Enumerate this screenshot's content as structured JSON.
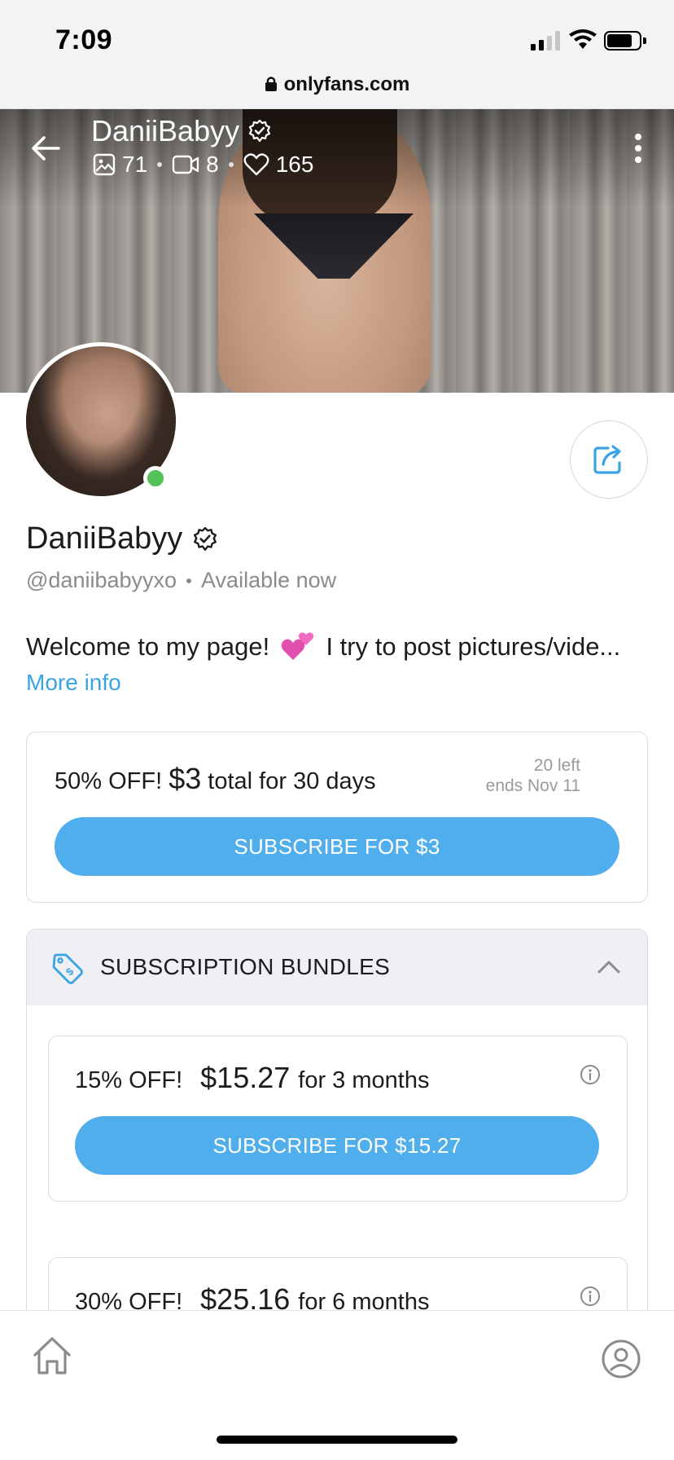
{
  "status_bar": {
    "time": "7:09"
  },
  "browser": {
    "url": "onlyfans.com"
  },
  "cover": {
    "name": "DaniiBabyy",
    "stats": {
      "photos": "71",
      "videos": "8",
      "likes": "165"
    }
  },
  "profile": {
    "name": "DaniiBabyy",
    "handle": "@daniibabyyxo",
    "status": "Available now",
    "bio_before": "Welcome to my page! ",
    "bio_after": " I try to post pictures/vide...",
    "more_info": "More info"
  },
  "offer": {
    "prefix": "50% OFF! ",
    "price": "$3",
    "suffix": " total for 30 days",
    "remaining": "20 left",
    "ends": "ends Nov 11",
    "button": "SUBSCRIBE FOR $3"
  },
  "bundles": {
    "title": "SUBSCRIPTION BUNDLES",
    "items": [
      {
        "discount": "15% OFF!",
        "price": "$15.27",
        "period": "for 3 months",
        "button": "SUBSCRIBE FOR $15.27"
      },
      {
        "discount": "30% OFF!",
        "price": "$25.16",
        "period": "for 6 months"
      }
    ]
  },
  "colors": {
    "accent": "#4faeeb",
    "link": "#3aa3e3",
    "online": "#55c157"
  },
  "icons": [
    "back-arrow-icon",
    "verified-icon",
    "image-icon",
    "video-icon",
    "heart-icon",
    "more-vertical-icon",
    "share-icon",
    "price-tag-icon",
    "chevron-up-icon",
    "info-icon",
    "home-icon",
    "profile-icon",
    "lock-icon"
  ]
}
